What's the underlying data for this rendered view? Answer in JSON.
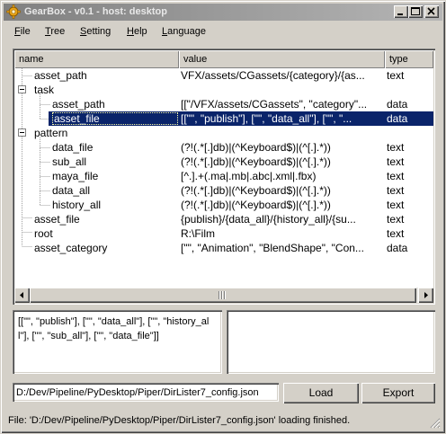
{
  "window": {
    "title": "GearBox - v0.1 - host: desktop",
    "icon": "gear-icon"
  },
  "menu": [
    {
      "label": "File",
      "key": "F"
    },
    {
      "label": "Tree",
      "key": "T"
    },
    {
      "label": "Setting",
      "key": "S"
    },
    {
      "label": "Help",
      "key": "H"
    },
    {
      "label": "Language",
      "key": "L"
    }
  ],
  "tree": {
    "columns": [
      "name",
      "value",
      "type"
    ],
    "rows": [
      {
        "name": "asset_path",
        "value": "VFX/assets/CGassets/{category}/{as...",
        "type": "text",
        "level": 1
      },
      {
        "name": "task",
        "value": "",
        "type": "",
        "level": 0,
        "expanded": true
      },
      {
        "name": "asset_path",
        "value": "[[\"/VFX/assets/CGassets\", \"category\"...",
        "type": "data",
        "level": 2
      },
      {
        "name": "asset_file",
        "value": "[[\"\", \"publish\"], [\"\", \"data_all\"], [\"\", \"...",
        "type": "data",
        "level": 2,
        "selected": true
      },
      {
        "name": "pattern",
        "value": "",
        "type": "",
        "level": 0,
        "expanded": true
      },
      {
        "name": "data_file",
        "value": "(?!(.*[.]db)|(^Keyboard$)|(^[.].*))",
        "type": "text",
        "level": 2
      },
      {
        "name": "sub_all",
        "value": "(?!(.*[.]db)|(^Keyboard$)|(^[.].*))",
        "type": "text",
        "level": 2
      },
      {
        "name": "maya_file",
        "value": "[^.].+(.ma|.mb|.abc|.xml|.fbx)",
        "type": "text",
        "level": 2
      },
      {
        "name": "data_all",
        "value": "(?!(.*[.]db)|(^Keyboard$)|(^[.].*))",
        "type": "text",
        "level": 2
      },
      {
        "name": "history_all",
        "value": "(?!(.*[.]db)|(^Keyboard$)|(^[.].*))",
        "type": "text",
        "level": 2
      },
      {
        "name": "asset_file",
        "value": "{publish}/{data_all}/{history_all}/{su...",
        "type": "text",
        "level": 1
      },
      {
        "name": "root",
        "value": "R:\\Film",
        "type": "text",
        "level": 1
      },
      {
        "name": "asset_category",
        "value": "[\"\", \"Animation\", \"BlendShape\", \"Con...",
        "type": "data",
        "level": 1
      }
    ]
  },
  "detail": {
    "left_text": "[[\"\", \"publish\"], [\"\", \"data_all\"], [\"\", \"history_all\"], [\"\", \"sub_all\"], [\"\", \"data_file\"]]",
    "right_text": ""
  },
  "config": {
    "path_value": "D:/Dev/Pipeline/PyDesktop/Piper/DirLister7_config.json",
    "load_label": "Load",
    "export_label": "Export"
  },
  "status": {
    "message": "File: 'D:/Dev/Pipeline/PyDesktop/Piper/DirLister7_config.json' loading finished."
  }
}
